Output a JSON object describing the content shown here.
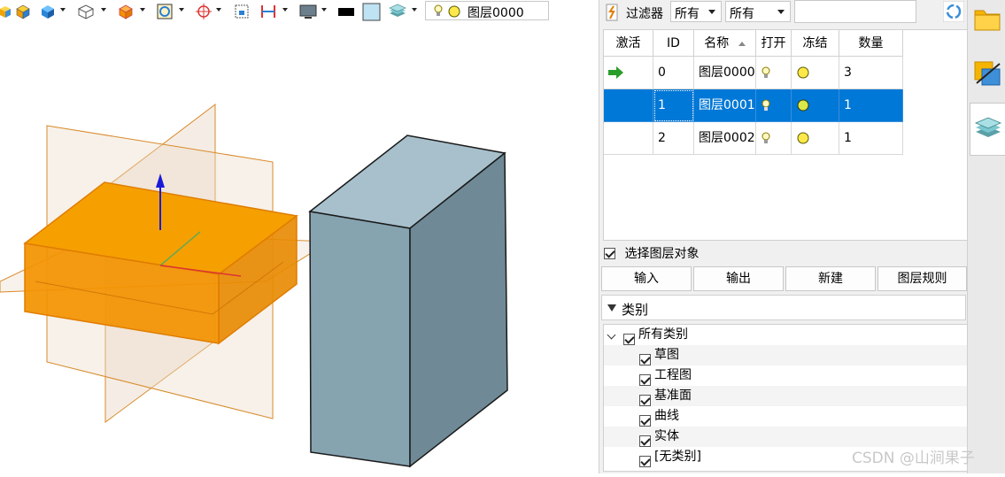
{
  "toolbar": {
    "layer_combo_value": "图层0000",
    "icons": [
      "shaded-solid-icon",
      "shaded-edges-icon",
      "wireframe-icon",
      "view-cube-icon",
      "zoom-fit-icon",
      "crosshair-icon",
      "select-box-icon",
      "dimension-icon",
      "display-mode-icon",
      "color-black-icon",
      "color-light-icon",
      "layers-icon",
      "bulb-icon",
      "freeze-icon"
    ]
  },
  "filter": {
    "label": "过滤器",
    "combo1": "所有",
    "combo2": "所有",
    "search_value": ""
  },
  "grid": {
    "headers": [
      "激活",
      "ID",
      "名称",
      "打开",
      "冻结",
      "数量"
    ],
    "rows": [
      {
        "active": true,
        "id": "0",
        "name": "图层0000",
        "count": "3",
        "selected": false
      },
      {
        "active": false,
        "id": "1",
        "name": "图层0001",
        "count": "1",
        "selected": true
      },
      {
        "active": false,
        "id": "2",
        "name": "图层0002",
        "count": "1",
        "selected": false
      }
    ]
  },
  "select_layer_objects": "选择图层对象",
  "buttons": {
    "import": "输入",
    "export": "输出",
    "new": "新建",
    "layer_rules": "图层规则"
  },
  "category": {
    "title": "类别",
    "root": "所有类别",
    "items": [
      "草图",
      "工程图",
      "基准面",
      "曲线",
      "实体",
      "[无类别]"
    ]
  },
  "watermark": "CSDN @山涧果子",
  "colors": {
    "selection": "#0078d7",
    "orange_body": "#f39200",
    "grey_block": "#86a3b0",
    "active_arrow": "#2a9d2a"
  }
}
